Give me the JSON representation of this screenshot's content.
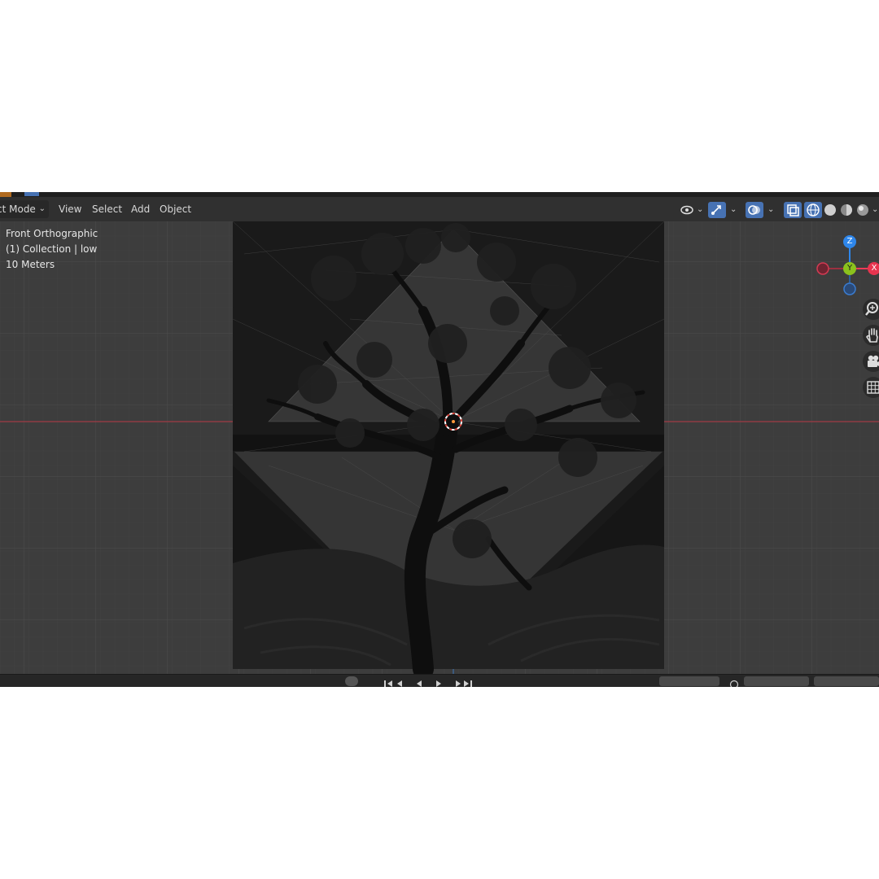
{
  "header": {
    "mode_label": "ct Mode",
    "menus": [
      "View",
      "Select",
      "Add",
      "Object"
    ]
  },
  "overlay": {
    "view_name": "Front Orthographic",
    "collection": "(1) Collection | low",
    "scale": "10 Meters"
  },
  "gizmo": {
    "z_label": "Z",
    "y_label": "Y",
    "x_label": "X"
  },
  "colors": {
    "accent_blue": "#4772b3",
    "axis_x": "#ff3352",
    "axis_y": "#8bdc00",
    "axis_z": "#2890ff",
    "viewport_bg": "#3d3d3d"
  },
  "icons": {
    "visibility": "eye-icon",
    "gizmo_toggle": "gizmo-icon",
    "overlays": "overlay-icon",
    "xray": "xray-icon",
    "wireframe": "wireframe-shading-icon",
    "solid": "solid-shading-icon",
    "material": "material-shading-icon",
    "rendered": "rendered-shading-icon",
    "zoom": "zoom-icon",
    "pan": "hand-icon",
    "camera": "camera-icon",
    "grid": "grid-icon"
  }
}
